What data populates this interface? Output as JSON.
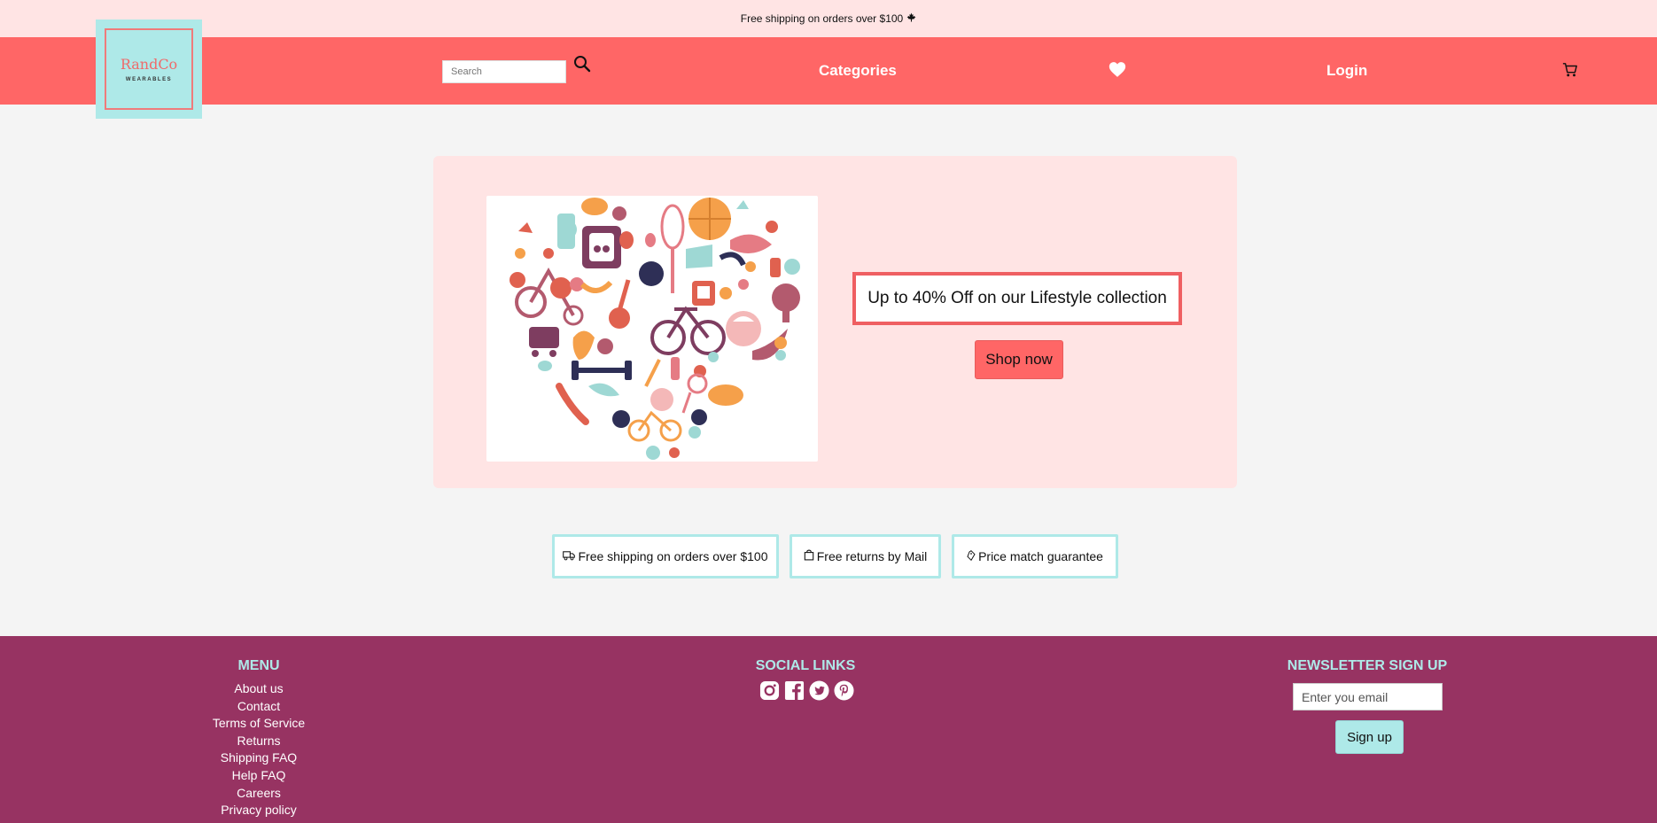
{
  "topbar": {
    "text": "Free shipping on orders over $100",
    "icon": "maple-leaf-icon"
  },
  "logo": {
    "name": "RandCo",
    "subtitle": "WEARABLES"
  },
  "nav": {
    "search_placeholder": "Search",
    "categories": "Categories",
    "login": "Login",
    "icons": [
      "search-icon",
      "heart-icon",
      "cart-icon"
    ]
  },
  "hero": {
    "image": "fitness-heart-illustration",
    "promo": "Up to 40% Off on our Lifestyle collection",
    "button": "Shop now"
  },
  "features": [
    {
      "icon": "truck-icon",
      "label": "Free shipping on orders over $100"
    },
    {
      "icon": "bag-icon",
      "label": "Free returns by Mail"
    },
    {
      "icon": "tag-icon",
      "label": "Price match guarantee"
    }
  ],
  "footer": {
    "menu_heading": "MENU",
    "menu_items": [
      "About us",
      "Contact",
      "Terms of Service",
      "Returns",
      "Shipping FAQ",
      "Help FAQ",
      "Careers",
      "Privacy policy"
    ],
    "social_heading": "SOCIAL LINKS",
    "socials": [
      "instagram-icon",
      "facebook-icon",
      "twitter-icon",
      "pinterest-icon"
    ],
    "newsletter_heading": "NEWSLETTER SIGN UP",
    "email_placeholder": "Enter you email",
    "signup": "Sign up"
  },
  "colors": {
    "topbar": "#ffe4e4",
    "nav": "#ff6666",
    "logo_bg": "#aee9e8",
    "footer": "#973362",
    "accent_teal": "#aee9e8",
    "promo_border": "#ef5f62"
  }
}
